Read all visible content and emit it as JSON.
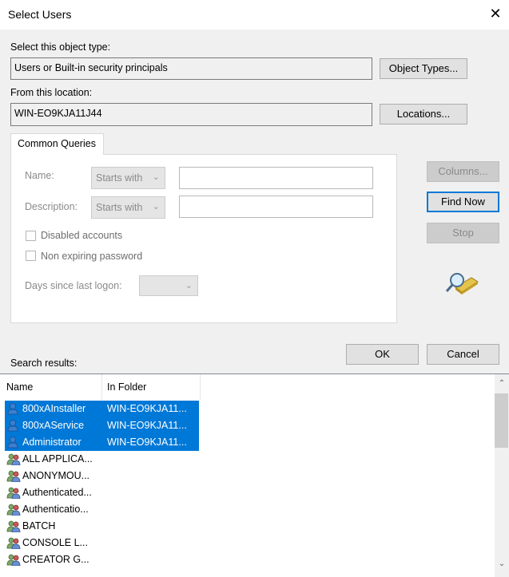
{
  "window": {
    "title": "Select Users",
    "close_glyph": "✕"
  },
  "object_type": {
    "label": "Select this object type:",
    "value": "Users or Built-in security principals",
    "button": "Object Types..."
  },
  "location": {
    "label": "From this location:",
    "value": "WIN-EO9KJA11J44",
    "button": "Locations..."
  },
  "tab": {
    "label": "Common Queries"
  },
  "query": {
    "name_label": "Name:",
    "name_mode": "Starts with",
    "name_value": "",
    "description_label": "Description:",
    "description_mode": "Starts with",
    "description_value": "",
    "disabled_accounts": "Disabled accounts",
    "non_expiring_password": "Non expiring password",
    "days_label": "Days since last logon:",
    "days_value": ""
  },
  "side_buttons": {
    "columns": "Columns...",
    "find_now": "Find Now",
    "stop": "Stop"
  },
  "dialog_buttons": {
    "ok": "OK",
    "cancel": "Cancel"
  },
  "results": {
    "label": "Search results:",
    "columns": [
      "Name",
      "In Folder"
    ],
    "rows": [
      {
        "name": "800xAInstaller",
        "folder": "WIN-EO9KJA11...",
        "icon": "user-icon",
        "selected": true
      },
      {
        "name": "800xAService",
        "folder": "WIN-EO9KJA11...",
        "icon": "user-icon",
        "selected": true
      },
      {
        "name": "Administrator",
        "folder": "WIN-EO9KJA11...",
        "icon": "user-icon",
        "selected": true
      },
      {
        "name": "ALL APPLICA...",
        "folder": "",
        "icon": "group-icon",
        "selected": false
      },
      {
        "name": "ANONYMOU...",
        "folder": "",
        "icon": "group-icon",
        "selected": false
      },
      {
        "name": "Authenticated...",
        "folder": "",
        "icon": "group-icon",
        "selected": false
      },
      {
        "name": "Authenticatio...",
        "folder": "",
        "icon": "group-icon",
        "selected": false
      },
      {
        "name": "BATCH",
        "folder": "",
        "icon": "group-icon",
        "selected": false
      },
      {
        "name": "CONSOLE L...",
        "folder": "",
        "icon": "group-icon",
        "selected": false
      },
      {
        "name": "CREATOR G...",
        "folder": "",
        "icon": "group-icon",
        "selected": false
      }
    ]
  },
  "colors": {
    "selection": "#0078d7",
    "default_button_border": "#0078d7",
    "dialog_bg": "#f0f0f0"
  }
}
